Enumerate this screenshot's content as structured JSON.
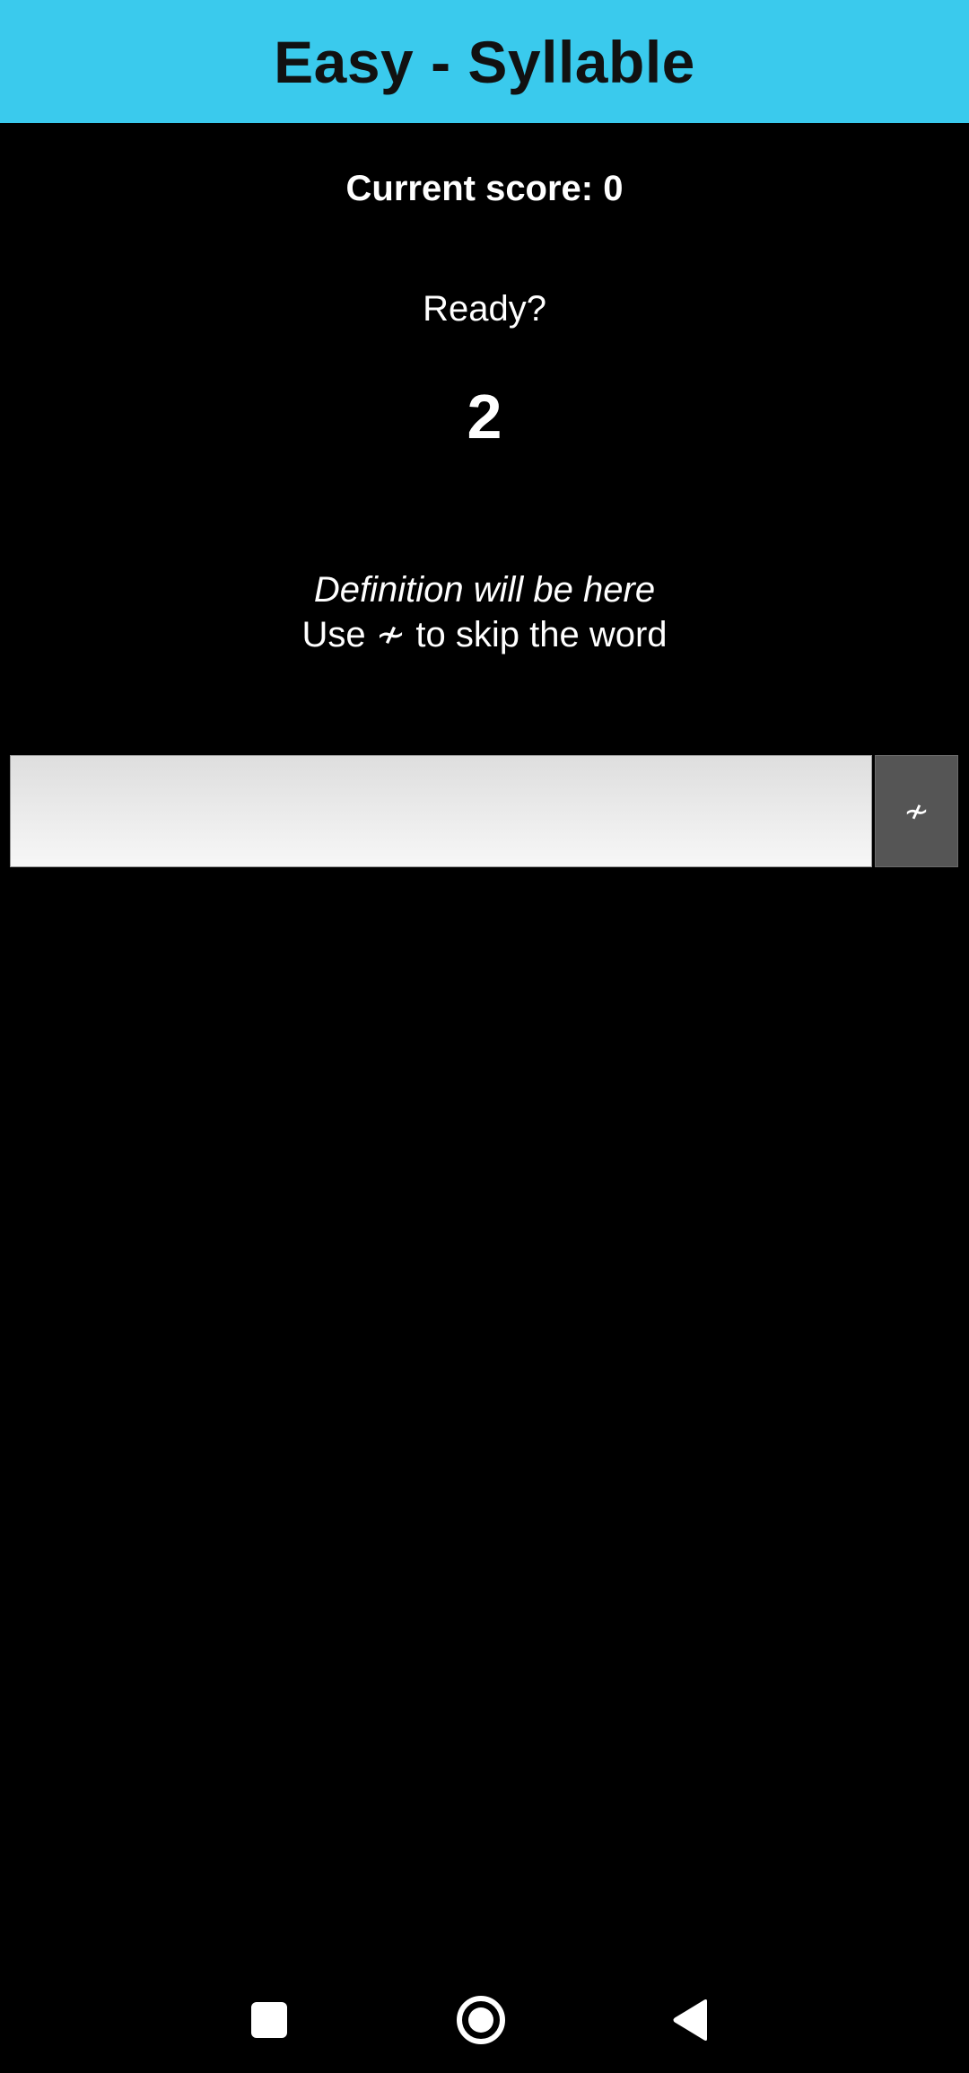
{
  "header": {
    "title": "Easy - Syllable",
    "background_color": "#3ACAED"
  },
  "game": {
    "score_text": "Current score: 0",
    "ready_text": "Ready?",
    "countdown": "2",
    "definition_text": "Definition will be here",
    "hint_prefix": "Use",
    "hint_suffix": "to skip the word",
    "skip_symbol": "≁"
  },
  "input": {
    "value": "",
    "placeholder": ""
  },
  "skip_button": {
    "label": "≁",
    "icon": "skip-icon"
  },
  "nav_bar": {
    "buttons": [
      "recents-icon",
      "home-icon",
      "back-icon"
    ]
  }
}
